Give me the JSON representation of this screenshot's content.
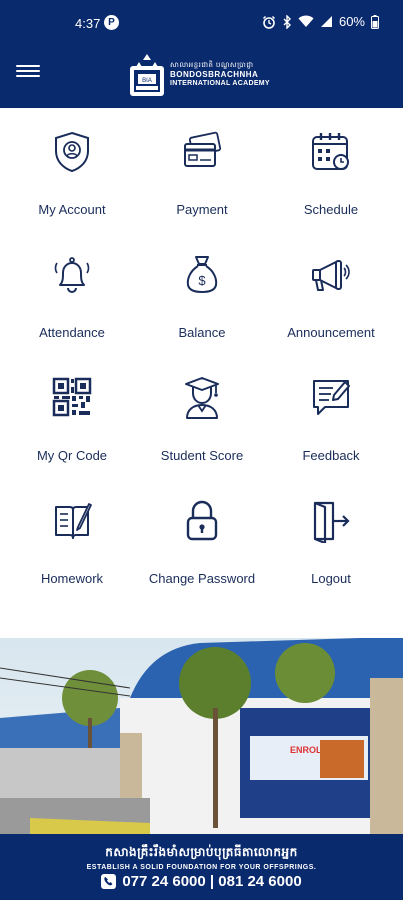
{
  "status_bar": {
    "time": "4:37",
    "notification_badge": "P",
    "battery_percent": "60%"
  },
  "header": {
    "menu_icon": "hamburger-icon",
    "logo": {
      "khmer_name": "សាលាអន្តរជាតិ បណ្ឌសប្រាជ្ញា",
      "name": "BONDOSBRACHNHA",
      "subtitle": "INTERNATIONAL ACADEMY"
    }
  },
  "menu": [
    {
      "label": "My Account",
      "icon": "shield-user-icon"
    },
    {
      "label": "Payment",
      "icon": "credit-card-icon"
    },
    {
      "label": "Schedule",
      "icon": "calendar-clock-icon"
    },
    {
      "label": "Attendance",
      "icon": "bell-icon"
    },
    {
      "label": "Balance",
      "icon": "money-bag-icon"
    },
    {
      "label": "Announcement",
      "icon": "megaphone-icon"
    },
    {
      "label": "My Qr Code",
      "icon": "qr-code-icon"
    },
    {
      "label": "Student Score",
      "icon": "graduate-icon"
    },
    {
      "label": "Feedback",
      "icon": "feedback-icon"
    },
    {
      "label": "Homework",
      "icon": "notebook-icon"
    },
    {
      "label": "Change Password",
      "icon": "lock-icon"
    },
    {
      "label": "Logout",
      "icon": "logout-icon"
    }
  ],
  "banner": {
    "khmer_slogan": "កសាងគ្រឹះរឹងមាំសម្រាប់បុត្រធីតាលោកអ្នក",
    "tagline": "ESTABLISH A SOLID FOUNDATION FOR YOUR OFFSPRINGS.",
    "phones": "077 24 6000 | 081 24 6000",
    "sign_text": "ENROLL NOW"
  },
  "colors": {
    "primary": "#0a2a6e",
    "icon": "#1a2d5a",
    "label": "#1a2d5a"
  }
}
